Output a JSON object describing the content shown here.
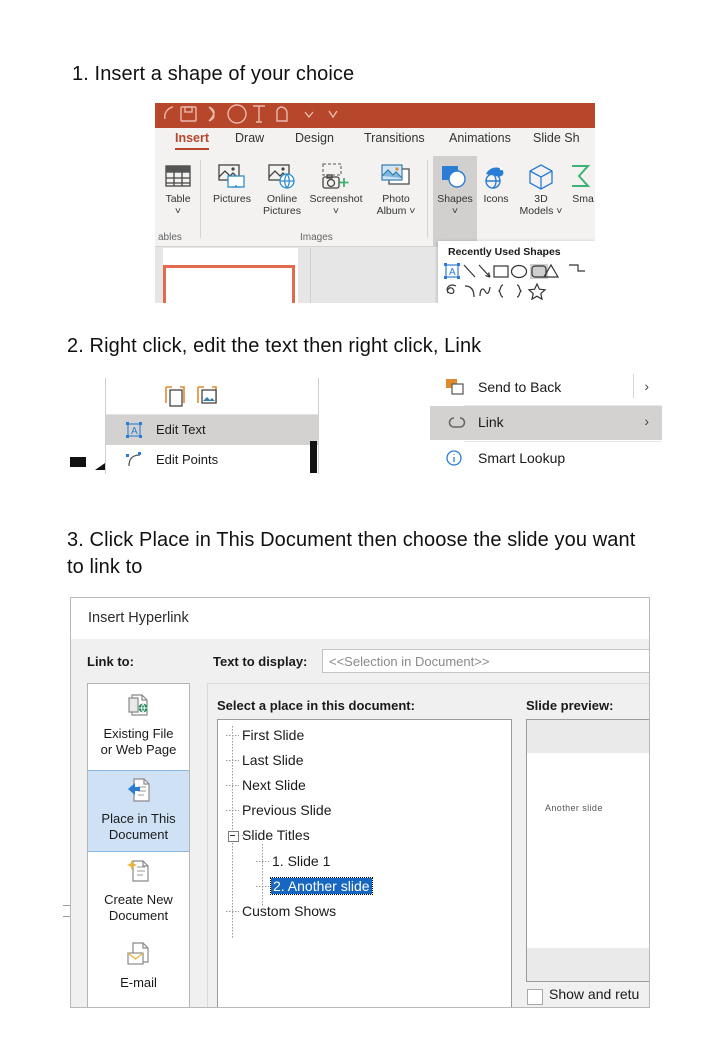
{
  "steps": [
    {
      "text": "1. Insert a shape of your choice"
    },
    {
      "text": "2. Right click, edit the text then right click, Link"
    },
    {
      "text": "3. Click Place in This Document then choose the slide you want to link to"
    }
  ],
  "ribbon": {
    "tabs": [
      {
        "label": "Insert",
        "active": true
      },
      {
        "label": "Draw",
        "active": false
      },
      {
        "label": "Design",
        "active": false
      },
      {
        "label": "Transitions",
        "active": false
      },
      {
        "label": "Animations",
        "active": false
      },
      {
        "label": "Slide Sh",
        "active": false
      }
    ],
    "items": [
      {
        "label": "Table",
        "label2": "˅",
        "icon": "table-icon"
      },
      {
        "label": "Pictures",
        "label2": "",
        "icon": "pictures-icon"
      },
      {
        "label": "Online",
        "label2": "Pictures",
        "icon": "online-pictures-icon"
      },
      {
        "label": "Screenshot",
        "label2": "˅",
        "icon": "screenshot-icon"
      },
      {
        "label": "Photo",
        "label2": "Album ˅",
        "icon": "photo-album-icon"
      },
      {
        "label": "Shapes",
        "label2": "˅",
        "icon": "shapes-icon",
        "selected": true
      },
      {
        "label": "Icons",
        "label2": "",
        "icon": "icons-icon"
      },
      {
        "label": "3D",
        "label2": "Models ˅",
        "icon": "3d-models-icon"
      },
      {
        "label": "Sma",
        "label2": "",
        "icon": "smartart-icon"
      }
    ],
    "group_labels": [
      {
        "label": "ables"
      },
      {
        "label": "Images"
      }
    ],
    "accent_color": "#b7472a"
  },
  "shapes_dropdown": {
    "title": "Recently Used Shapes",
    "row1": [
      "text-box-shape",
      "line-shape",
      "arrow-shape",
      "rectangle-shape",
      "oval-shape",
      "rounded-rectangle-shape",
      "triangle-shape",
      "elbow-connector-shape"
    ],
    "row2": [
      "scribble-shape",
      "curve-shape",
      "arc-shape",
      "left-brace-shape",
      "right-brace-shape",
      "star-shape"
    ],
    "selected_index": 5
  },
  "context_menu_left": {
    "items": [
      {
        "label": "Edit Text",
        "icon": "edit-text-icon",
        "highlighted": true
      },
      {
        "label": "Edit Points",
        "icon": "edit-points-icon",
        "highlighted": false
      }
    ],
    "paste_icons": [
      "paste-keep-text-icon",
      "paste-picture-icon"
    ]
  },
  "context_menu_right": {
    "items": [
      {
        "label": "Send to Back",
        "icon": "send-to-back-icon",
        "submenu": "›",
        "highlighted": false
      },
      {
        "label": "Link",
        "icon": "link-icon",
        "submenu": "›",
        "highlighted": true
      },
      {
        "label": "Smart Lookup",
        "icon": "smart-lookup-icon",
        "submenu": "",
        "highlighted": false
      }
    ]
  },
  "dialog": {
    "title": "Insert Hyperlink",
    "link_to_label": "Link to:",
    "text_to_display_label": "Text to display:",
    "text_to_display_value": "<<Selection in Document>>",
    "rail": [
      {
        "label_line1": "Existing File",
        "label_line2": "or Web Page",
        "icon": "existing-file-icon",
        "selected": false
      },
      {
        "label_line1": "Place in This",
        "label_line2": "Document",
        "icon": "place-in-document-icon",
        "selected": true
      },
      {
        "label_line1": "Create New",
        "label_line2": "Document",
        "icon": "create-new-document-icon",
        "selected": false
      },
      {
        "label_line1": "E-mail",
        "label_line2": "",
        "icon": "email-icon",
        "selected": false
      }
    ],
    "select_place_label": "Select a place in this document:",
    "tree": [
      {
        "label": "First Slide",
        "level": 0,
        "selected": false,
        "expander": false
      },
      {
        "label": "Last Slide",
        "level": 0,
        "selected": false,
        "expander": false
      },
      {
        "label": "Next Slide",
        "level": 0,
        "selected": false,
        "expander": false
      },
      {
        "label": "Previous Slide",
        "level": 0,
        "selected": false,
        "expander": false
      },
      {
        "label": "Slide Titles",
        "level": 0,
        "selected": false,
        "expander": true
      },
      {
        "label": "1. Slide 1",
        "level": 1,
        "selected": false,
        "expander": false
      },
      {
        "label": "2. Another slide",
        "level": 1,
        "selected": true,
        "expander": false
      },
      {
        "label": "Custom Shows",
        "level": 0,
        "selected": false,
        "expander": false
      }
    ],
    "slide_preview_label": "Slide preview:",
    "slide_preview_text": "Another slide",
    "checkbox_label": "Show and retu",
    "checkbox_checked": false,
    "selection_color": "#1767c0",
    "rail_selected_color": "#cfe2f5"
  }
}
